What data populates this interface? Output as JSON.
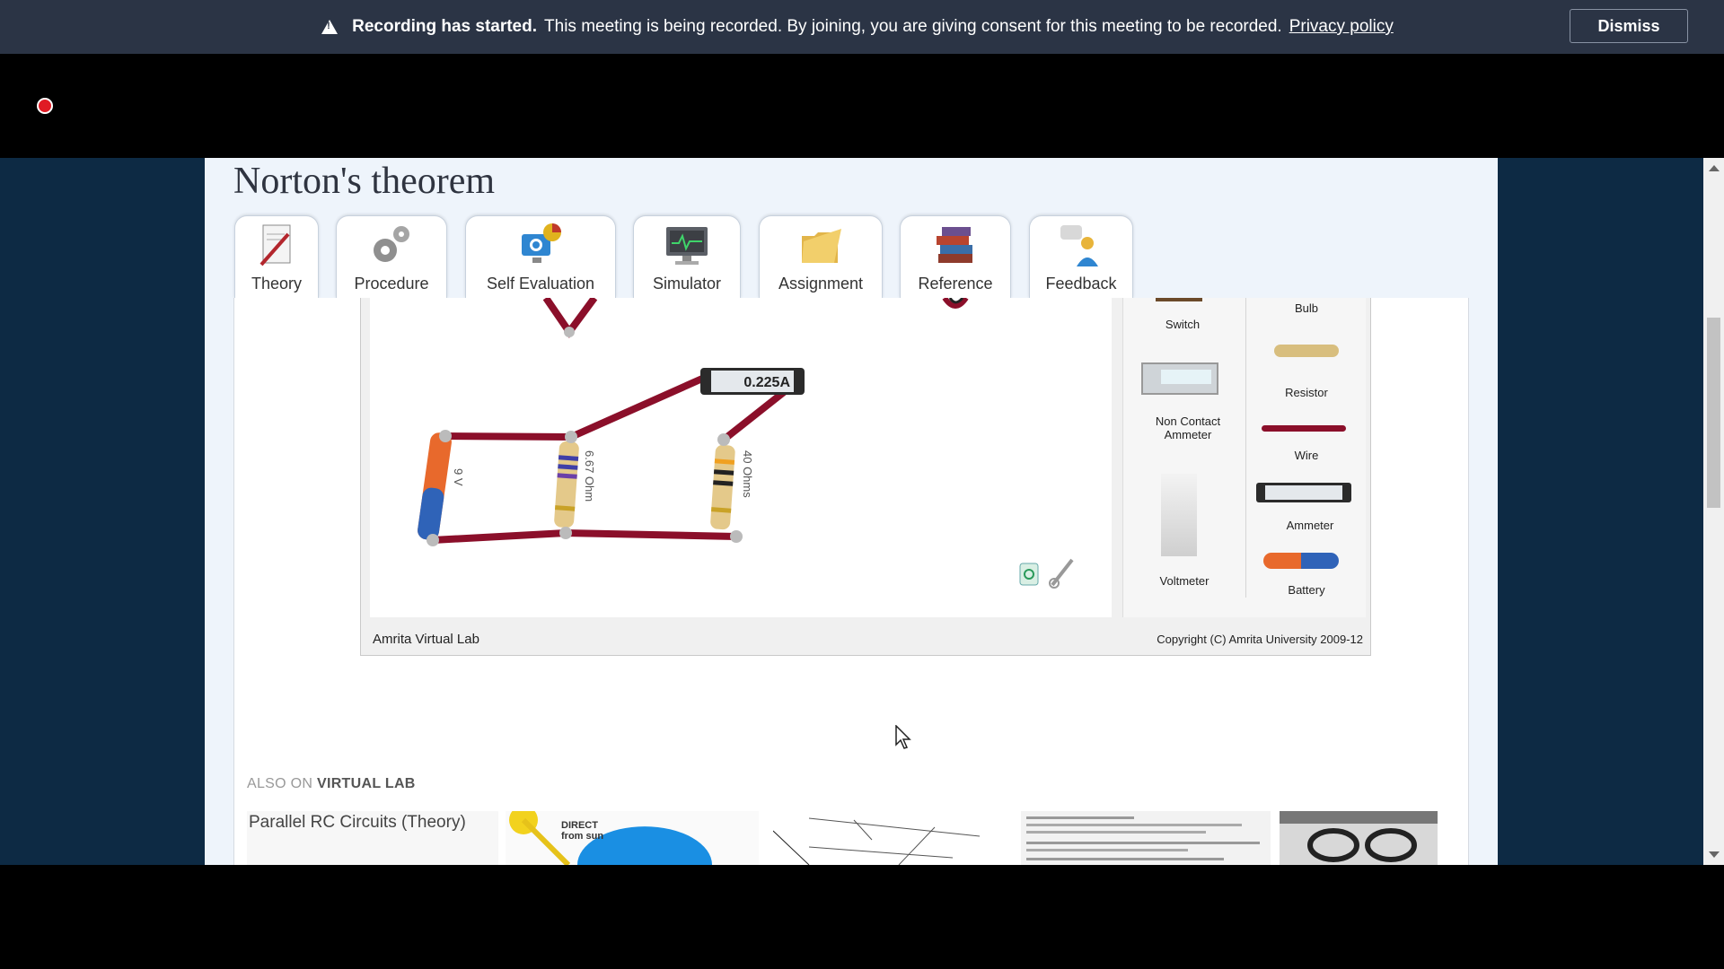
{
  "banner": {
    "bold": "Recording has started.",
    "text": "This meeting is being recorded. By joining, you are giving consent for this meeting to be recorded.",
    "link": "Privacy policy",
    "dismiss": "Dismiss"
  },
  "page": {
    "title": "Norton's theorem",
    "tabs": [
      "Theory",
      "Procedure",
      "Self Evaluation",
      "Simulator",
      "Assignment",
      "Reference",
      "Feedback"
    ]
  },
  "simulator": {
    "ammeter_reading": "0.225A",
    "battery_label": "9 V",
    "resistor1_label": "6.67 Ohm",
    "resistor2_label": "40 Ohms",
    "palette": {
      "switch": "Switch",
      "bulb": "Bulb",
      "resistor": "Resistor",
      "non_contact_ammeter": "Non Contact Ammeter",
      "wire": "Wire",
      "ammeter": "Ammeter",
      "voltmeter": "Voltmeter",
      "battery": "Battery"
    },
    "footer_left": "Amrita Virtual Lab",
    "footer_right": "Copyright (C) Amrita University 2009-12"
  },
  "also": {
    "prefix": "ALSO ON",
    "site": "VIRTUAL LAB",
    "first_alt": "Parallel RC Circuits (Theory)",
    "second_text": "DIRECT from sun"
  },
  "colors": {
    "banner_bg": "#2b3445",
    "wire": "#8b0f2a",
    "page_bg": "#eef4fb",
    "rec": "#e01b24"
  }
}
